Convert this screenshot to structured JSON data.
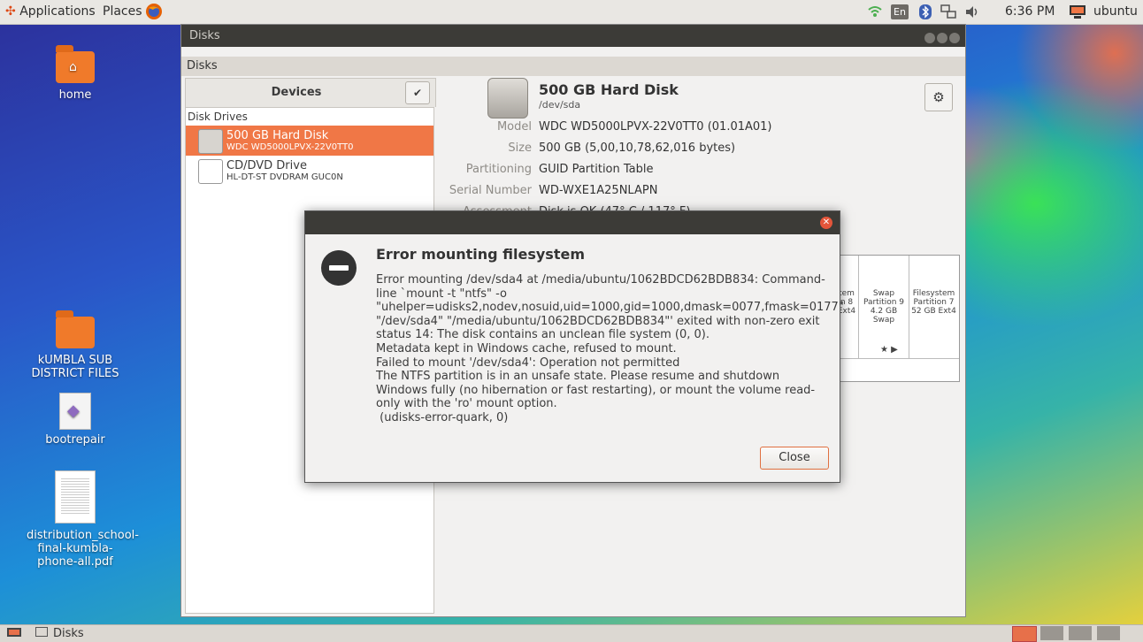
{
  "topbar": {
    "applications": "Applications",
    "places": "Places",
    "keyboard_layout": "En",
    "time": "6:36 PM",
    "user": "ubuntu"
  },
  "desktop_icons": [
    {
      "label": "home"
    },
    {
      "label": "kUMBLA SUB DISTRICT FILES"
    },
    {
      "label": "bootrepair"
    },
    {
      "label": "distribution_school-final-kumbla-phone-all.pdf"
    }
  ],
  "window": {
    "title": "Disks",
    "menubar": "Disks"
  },
  "devices": {
    "header": "Devices",
    "section": "Disk Drives",
    "drives": [
      {
        "name": "500 GB Hard Disk",
        "sub": "WDC WD5000LPVX-22V0TT0"
      },
      {
        "name": "CD/DVD Drive",
        "sub": "HL-DT-ST DVDRAM GUC0N"
      }
    ]
  },
  "disk": {
    "title": "500 GB Hard Disk",
    "device": "/dev/sda",
    "props": [
      {
        "key": "Model",
        "value": "WDC WD5000LPVX-22V0TT0 (01.01A01)"
      },
      {
        "key": "Size",
        "value": "500 GB (5,00,10,78,62,016 bytes)"
      },
      {
        "key": "Partitioning",
        "value": "GUID Partition Table"
      },
      {
        "key": "Serial Number",
        "value": "WD-WXE1A25NLAPN"
      },
      {
        "key": "Assessment",
        "value": "Disk is OK (47° C / 117° F)"
      }
    ]
  },
  "volumes": {
    "cells": [
      {
        "l1": "tem",
        "l2": "n 8",
        "l3": "Ext4"
      },
      {
        "l1": "Swap",
        "l2": "Partition 9",
        "l3": "4.2 GB Swap"
      },
      {
        "l1": "Filesystem",
        "l2": "Partition 7",
        "l3": "52 GB Ext4"
      }
    ]
  },
  "dialog": {
    "heading": "Error mounting filesystem",
    "message": "Error mounting /dev/sda4 at /media/ubuntu/1062BDCD62BDB834: Command-line `mount -t \"ntfs\" -o \"uhelper=udisks2,nodev,nosuid,uid=1000,gid=1000,dmask=0077,fmask=0177\" \"/dev/sda4\" \"/media/ubuntu/1062BDCD62BDB834\"' exited with non-zero exit status 14: The disk contains an unclean file system (0, 0).\nMetadata kept in Windows cache, refused to mount.\nFailed to mount '/dev/sda4': Operation not permitted\nThe NTFS partition is in an unsafe state. Please resume and shutdown Windows fully (no hibernation or fast restarting), or mount the volume read-only with the 'ro' mount option.\n (udisks-error-quark, 0)",
    "close_label": "Close"
  },
  "taskbar": {
    "item": "Disks"
  }
}
